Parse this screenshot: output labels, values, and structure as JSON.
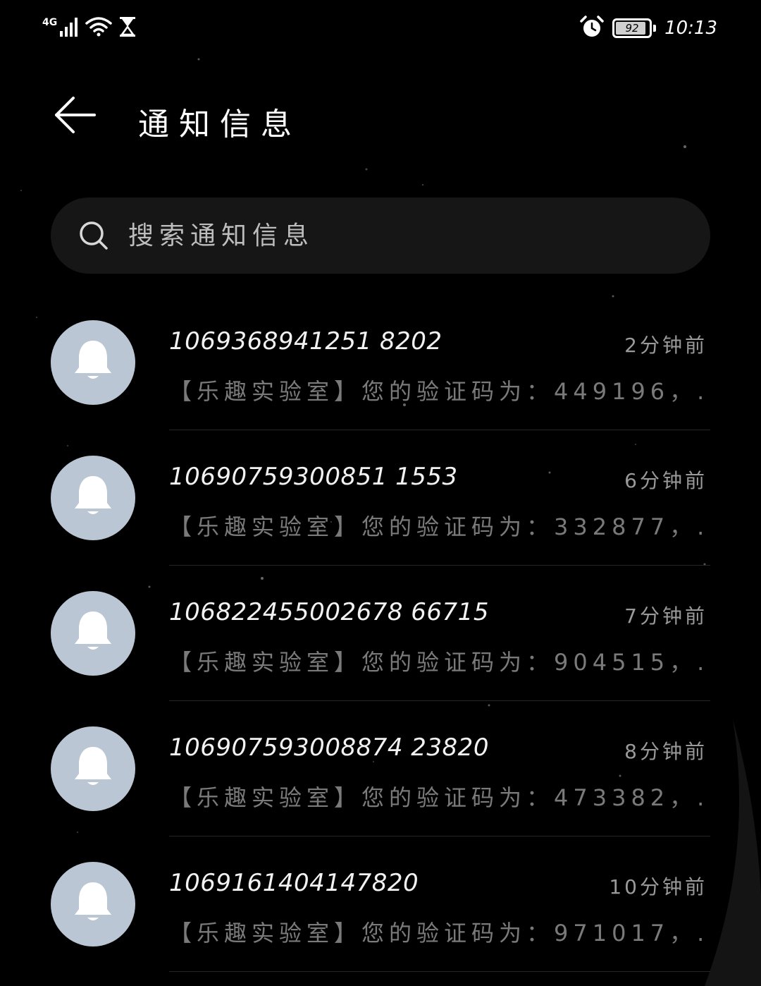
{
  "status_bar": {
    "network": "4G",
    "battery": "92",
    "battery_level": 0.92,
    "time": "10:13",
    "icons": [
      "signal-icon",
      "wifi-icon",
      "hourglass-icon",
      "alarm-icon",
      "battery-icon"
    ]
  },
  "header": {
    "back_icon": "back-arrow-icon",
    "title": "通知信息"
  },
  "search": {
    "placeholder": "搜索通知信息",
    "icon": "search-icon"
  },
  "notifications": [
    {
      "sender": "1069368941251 8202",
      "time": "2分钟前",
      "preview": "【乐趣实验室】您的验证码为：449196，...",
      "icon": "bell-icon"
    },
    {
      "sender": "10690759300851 1553",
      "time": "6分钟前",
      "preview": "【乐趣实验室】您的验证码为：332877，...",
      "icon": "bell-icon"
    },
    {
      "sender": "106822455002678 66715",
      "time": "7分钟前",
      "preview": "【乐趣实验室】您的验证码为：904515，...",
      "icon": "bell-icon"
    },
    {
      "sender": "106907593008874 23820",
      "time": "8分钟前",
      "preview": "【乐趣实验室】您的验证码为：473382，...",
      "icon": "bell-icon"
    },
    {
      "sender": "1069161404147820",
      "time": "10分钟前",
      "preview": "【乐趣实验室】您的验证码为：971017，...",
      "icon": "bell-icon"
    }
  ],
  "colors": {
    "background": "#000000",
    "search_bg": "#161616",
    "avatar_bg": "#bac6d3",
    "text_primary": "#f2f2f2",
    "text_secondary": "#7a7a7a",
    "divider": "#262626"
  }
}
